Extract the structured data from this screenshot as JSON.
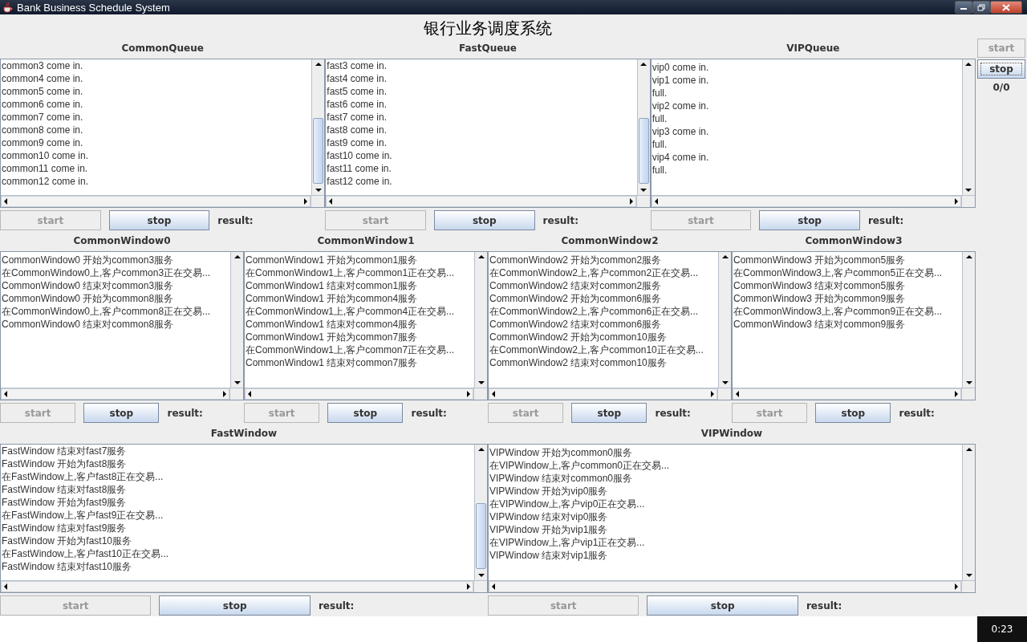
{
  "window": {
    "title": "Bank Business Schedule System"
  },
  "heading": "银行业务调度系统",
  "rows": [
    {
      "panels": [
        {
          "title": "CommonQueue",
          "scrolled": true,
          "lines": [
            "common3 come in.",
            "common4 come in.",
            "common5 come in.",
            "common6 come in.",
            "common7 come in.",
            "common8 come in.",
            "common9 come in.",
            "common10 come in.",
            "common11 come in.",
            "common12 come in."
          ],
          "buttons": [
            {
              "label": "start",
              "disabled": true
            },
            {
              "label": "stop",
              "disabled": false
            }
          ],
          "result": "result:"
        },
        {
          "title": "FastQueue",
          "scrolled": true,
          "lines": [
            "fast3 come in.",
            "fast4 come in.",
            "fast5 come in.",
            "fast6 come in.",
            "fast7 come in.",
            "fast8 come in.",
            "fast9 come in.",
            "fast10 come in.",
            "fast11 come in.",
            "fast12 come in."
          ],
          "buttons": [
            {
              "label": "start",
              "disabled": true
            },
            {
              "label": "stop",
              "disabled": false
            }
          ],
          "result": "result:"
        },
        {
          "title": "VIPQueue",
          "scrolled": false,
          "lines": [
            "vip0 come in.",
            "vip1 come in.",
            "full.",
            "vip2 come in.",
            "full.",
            "vip3 come in.",
            "full.",
            "vip4 come in.",
            "full."
          ],
          "buttons": [
            {
              "label": "start",
              "disabled": true
            },
            {
              "label": "stop",
              "disabled": false
            }
          ],
          "result": "result:"
        }
      ]
    },
    {
      "panels": [
        {
          "title": "CommonWindow0",
          "scrolled": false,
          "lines": [
            "CommonWindow0 开始为common3服务",
            "在CommonWindow0上,客户common3正在交易...",
            "CommonWindow0 结束对common3服务",
            "CommonWindow0 开始为common8服务",
            "在CommonWindow0上,客户common8正在交易...",
            "CommonWindow0 结束对common8服务"
          ],
          "buttons": [
            {
              "label": "start",
              "disabled": true
            },
            {
              "label": "stop",
              "disabled": false
            }
          ],
          "result": "result:"
        },
        {
          "title": "CommonWindow1",
          "scrolled": false,
          "lines": [
            "CommonWindow1 开始为common1服务",
            "在CommonWindow1上,客户common1正在交易...",
            "CommonWindow1 结束对common1服务",
            "CommonWindow1 开始为common4服务",
            "在CommonWindow1上,客户common4正在交易...",
            "CommonWindow1 结束对common4服务",
            "CommonWindow1 开始为common7服务",
            "在CommonWindow1上,客户common7正在交易...",
            "CommonWindow1 结束对common7服务"
          ],
          "buttons": [
            {
              "label": "start",
              "disabled": true
            },
            {
              "label": "stop",
              "disabled": false
            }
          ],
          "result": "result:"
        },
        {
          "title": "CommonWindow2",
          "scrolled": false,
          "lines": [
            "CommonWindow2 开始为common2服务",
            "在CommonWindow2上,客户common2正在交易...",
            "CommonWindow2 结束对common2服务",
            "CommonWindow2 开始为common6服务",
            "在CommonWindow2上,客户common6正在交易...",
            "CommonWindow2 结束对common6服务",
            "CommonWindow2 开始为common10服务",
            "在CommonWindow2上,客户common10正在交易...",
            "CommonWindow2 结束对common10服务"
          ],
          "buttons": [
            {
              "label": "start",
              "disabled": true
            },
            {
              "label": "stop",
              "disabled": false
            }
          ],
          "result": "result:"
        },
        {
          "title": "CommonWindow3",
          "scrolled": false,
          "lines": [
            "CommonWindow3 开始为common5服务",
            "在CommonWindow3上,客户common5正在交易...",
            "CommonWindow3 结束对common5服务",
            "CommonWindow3 开始为common9服务",
            "在CommonWindow3上,客户common9正在交易...",
            "CommonWindow3 结束对common9服务"
          ],
          "buttons": [
            {
              "label": "start",
              "disabled": true
            },
            {
              "label": "stop",
              "disabled": false
            }
          ],
          "result": "result:"
        }
      ]
    },
    {
      "panels": [
        {
          "title": "FastWindow",
          "scrolled": true,
          "lines": [
            "FastWindow 结束对fast7服务",
            "FastWindow 开始为fast8服务",
            "在FastWindow上,客户fast8正在交易...",
            "FastWindow 结束对fast8服务",
            "FastWindow 开始为fast9服务",
            "在FastWindow上,客户fast9正在交易...",
            "FastWindow 结束对fast9服务",
            "FastWindow 开始为fast10服务",
            "在FastWindow上,客户fast10正在交易...",
            "FastWindow 结束对fast10服务"
          ],
          "buttons": [
            {
              "label": "start",
              "disabled": true
            },
            {
              "label": "stop",
              "disabled": false
            }
          ],
          "result": "result:"
        },
        {
          "title": "VIPWindow",
          "scrolled": false,
          "lines": [
            "VIPWindow 开始为common0服务",
            "在VIPWindow上,客户common0正在交易...",
            "VIPWindow 结束对common0服务",
            "VIPWindow 开始为vip0服务",
            "在VIPWindow上,客户vip0正在交易...",
            "VIPWindow 结束对vip0服务",
            "VIPWindow 开始为vip1服务",
            "在VIPWindow上,客户vip1正在交易...",
            "VIPWindow 结束对vip1服务"
          ],
          "buttons": [
            {
              "label": "start",
              "disabled": true
            },
            {
              "label": "stop",
              "disabled": false
            }
          ],
          "result": "result:"
        }
      ]
    }
  ],
  "control": {
    "buttons": [
      {
        "label": "start",
        "disabled": true,
        "focused": false
      },
      {
        "label": "stop",
        "disabled": false,
        "focused": true
      }
    ],
    "count": "0/0"
  },
  "taskbar": {
    "time": "0:23"
  }
}
